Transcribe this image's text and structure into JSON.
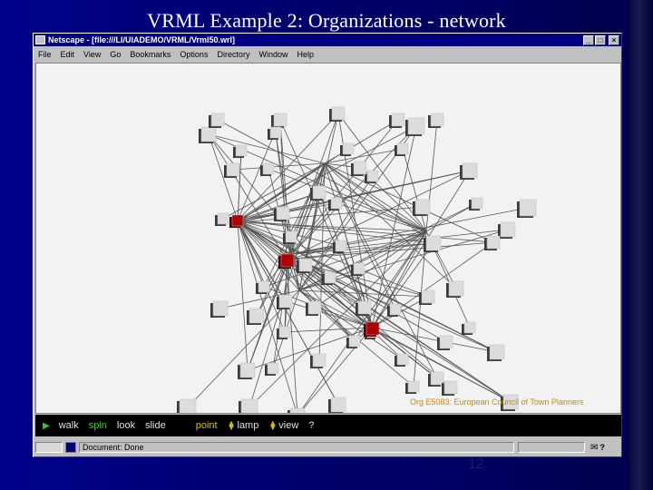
{
  "slide": {
    "title": "VRML Example 2: Organizations - network",
    "page_number": "12"
  },
  "window": {
    "title": "Netscape - [file:///LI/UIADEMO/VRML/Vrml50.wrl]",
    "minimize": "_",
    "maximize": "□",
    "close": "×"
  },
  "menu": [
    "File",
    "Edit",
    "View",
    "Go",
    "Bookmarks",
    "Options",
    "Directory",
    "Window",
    "Help"
  ],
  "viewer": {
    "org_label": "Org E5083: European Council of Town Planners",
    "nav": {
      "walk": "walk",
      "spin": "spin",
      "look": "look",
      "slide": "slide",
      "point": "point",
      "lamp": "lamp",
      "view": "view",
      "help": "?"
    }
  },
  "status": {
    "text": "Document: Done"
  },
  "colors": {
    "slide_bg": "#000080",
    "titlebar": "#000080",
    "viewport_bg": "#f2f2f2",
    "node": "#dcdcdc",
    "node_selected": "#b00000",
    "link": "#555555",
    "nav_active": "#40c040",
    "org_label": "#cc8800"
  },
  "icons": {
    "play": "play-icon",
    "mail": "mail-icon",
    "help": "help-icon"
  }
}
